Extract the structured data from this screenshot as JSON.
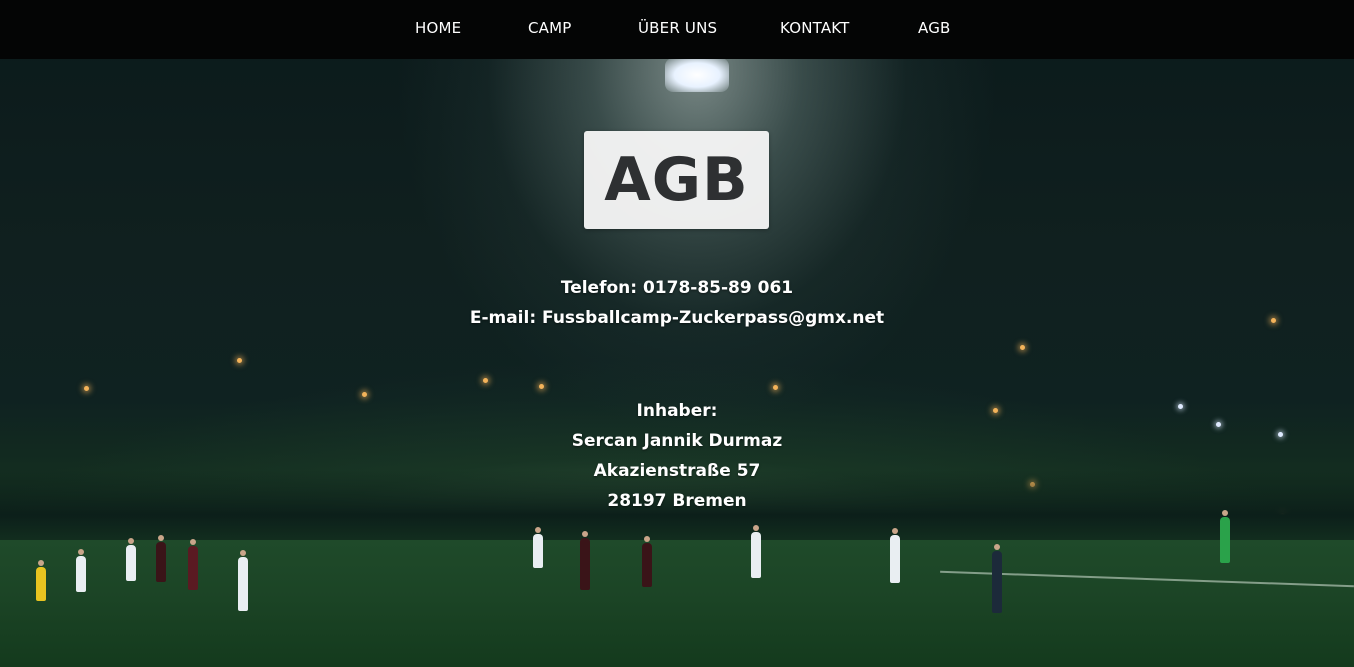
{
  "nav": {
    "items": [
      {
        "label": "HOME"
      },
      {
        "label": "CAMP"
      },
      {
        "label": "ÜBER UNS"
      },
      {
        "label": "KONTAKT"
      },
      {
        "label": "AGB"
      }
    ]
  },
  "page": {
    "title": "AGB"
  },
  "contact": {
    "phone_line": "Telefon: 0178-85-89 061",
    "email_line": "E-mail: Fussballcamp-Zuckerpass@gmx.net"
  },
  "owner": {
    "label": "Inhaber:",
    "name": "Sercan Jannik Durmaz",
    "street": "Akazienstraße 57",
    "city": "28197 Bremen"
  },
  "colors": {
    "navbar_bg": "#040505",
    "title_box_bg": "#f5f5f5",
    "title_text": "#2e3032",
    "body_text": "#ffffff"
  },
  "background": {
    "scene": "night-football-field-photo"
  }
}
